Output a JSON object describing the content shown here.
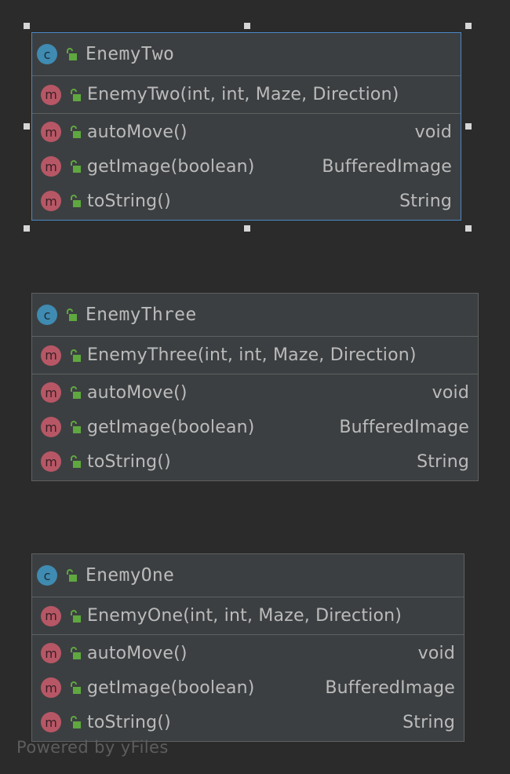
{
  "diagram": {
    "classes": [
      {
        "name": "EnemyTwo",
        "selected": true,
        "constructor": "EnemyTwo(int, int, Maze, Direction)",
        "methods": [
          {
            "signature": "autoMove()",
            "return_type": "void"
          },
          {
            "signature": "getImage(boolean)",
            "return_type": "BufferedImage"
          },
          {
            "signature": "toString()",
            "return_type": "String"
          }
        ]
      },
      {
        "name": "EnemyThree",
        "selected": false,
        "constructor": "EnemyThree(int, int, Maze, Direction)",
        "methods": [
          {
            "signature": "autoMove()",
            "return_type": "void"
          },
          {
            "signature": "getImage(boolean)",
            "return_type": "BufferedImage"
          },
          {
            "signature": "toString()",
            "return_type": "String"
          }
        ]
      },
      {
        "name": "EnemyOne",
        "selected": false,
        "constructor": "EnemyOne(int, int, Maze, Direction)",
        "methods": [
          {
            "signature": "autoMove()",
            "return_type": "void"
          },
          {
            "signature": "getImage(boolean)",
            "return_type": "BufferedImage"
          },
          {
            "signature": "toString()",
            "return_type": "String"
          }
        ]
      }
    ],
    "badges": {
      "class_letter": "c",
      "method_letter": "m"
    },
    "icons": {
      "class_badge": "class-icon",
      "method_badge": "method-icon",
      "visibility": "public-lock-icon"
    },
    "colors": {
      "background": "#2b2b2b",
      "node_fill": "#3c3f41",
      "node_border": "#5e6060",
      "selection_border": "#4a88c7",
      "class_badge": "#3f8bb1",
      "method_badge": "#b75766",
      "lock_green": "#5fa840",
      "text": "#bbbbbb"
    }
  },
  "watermark": "Powered by yFiles"
}
